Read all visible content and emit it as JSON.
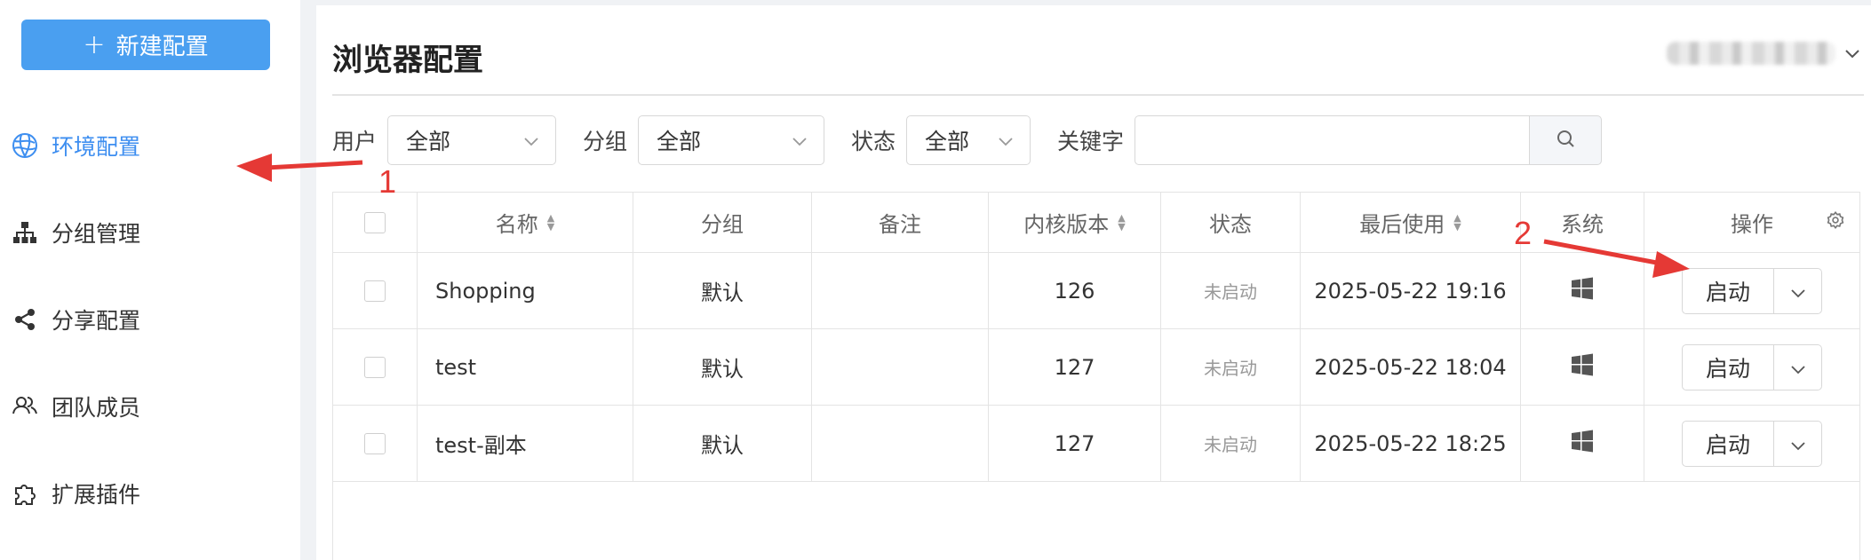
{
  "sidebar": {
    "new_button": "新建配置",
    "items": [
      {
        "label": "环境配置",
        "icon": "globe-icon",
        "active": true
      },
      {
        "label": "分组管理",
        "icon": "org-chart-icon",
        "active": false
      },
      {
        "label": "分享配置",
        "icon": "share-icon",
        "active": false
      },
      {
        "label": "团队成员",
        "icon": "team-icon",
        "active": false
      },
      {
        "label": "扩展插件",
        "icon": "puzzle-icon",
        "active": false
      }
    ]
  },
  "header": {
    "title": "浏览器配置"
  },
  "filters": {
    "user_label": "用户",
    "user_value": "全部",
    "group_label": "分组",
    "group_value": "全部",
    "status_label": "状态",
    "status_value": "全部",
    "keyword_label": "关键字",
    "keyword_value": ""
  },
  "table": {
    "columns": [
      "名称",
      "分组",
      "备注",
      "内核版本",
      "状态",
      "最后使用",
      "系统",
      "操作"
    ],
    "rows": [
      {
        "name": "Shopping",
        "group": "默认",
        "note": "",
        "kernel": "126",
        "status": "未启动",
        "last_used": "2025-05-22 19:16",
        "os": "windows-icon",
        "action": "启动"
      },
      {
        "name": "test",
        "group": "默认",
        "note": "",
        "kernel": "127",
        "status": "未启动",
        "last_used": "2025-05-22 18:04",
        "os": "windows-icon",
        "action": "启动"
      },
      {
        "name": "test-副本",
        "group": "默认",
        "note": "",
        "kernel": "127",
        "status": "未启动",
        "last_used": "2025-05-22 18:25",
        "os": "windows-icon",
        "action": "启动"
      }
    ]
  },
  "annotations": {
    "marker1": "1",
    "marker2": "2"
  },
  "colors": {
    "accent": "#4a9ff0",
    "active_nav": "#3d8ef0",
    "annotation": "#e53935"
  }
}
